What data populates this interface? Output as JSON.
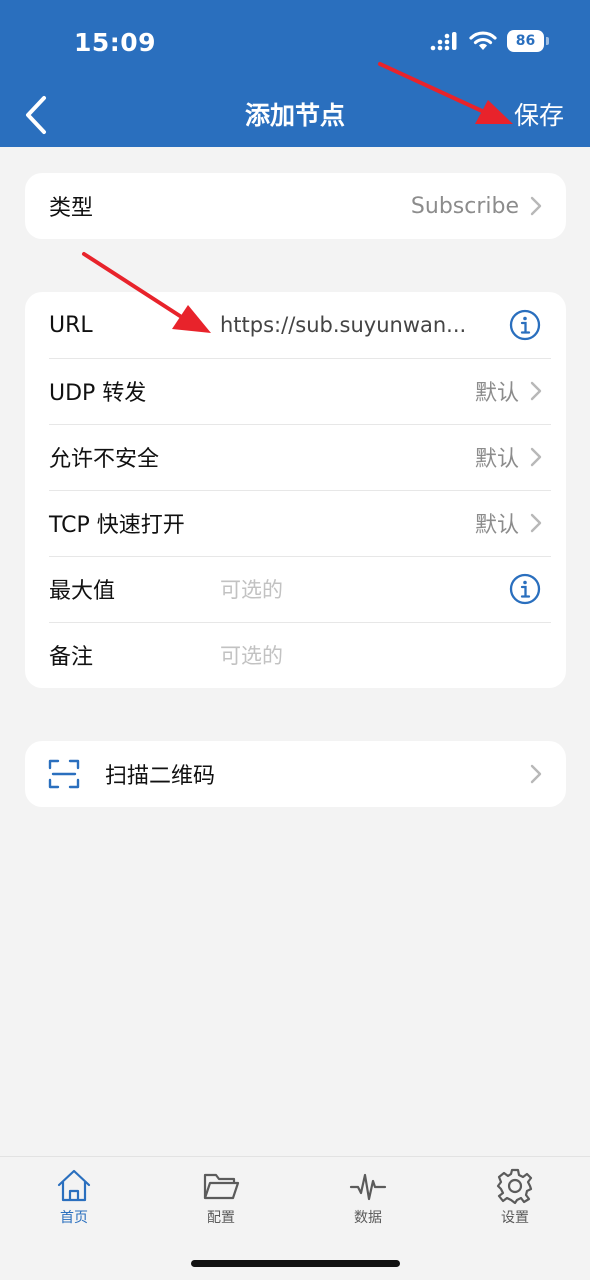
{
  "status_bar": {
    "time": "15:09",
    "battery": "86"
  },
  "nav": {
    "title": "添加节点",
    "save_label": "保存"
  },
  "type_row": {
    "label": "类型",
    "value": "Subscribe"
  },
  "form": {
    "url": {
      "label": "URL",
      "value": "https://sub.suyunwan..."
    },
    "udp": {
      "label": "UDP 转发",
      "value": "默认"
    },
    "insecure": {
      "label": "允许不安全",
      "value": "默认"
    },
    "tcp_fast_open": {
      "label": "TCP 快速打开",
      "value": "默认"
    },
    "max": {
      "label": "最大值",
      "placeholder": "可选的"
    },
    "note": {
      "label": "备注",
      "placeholder": "可选的"
    }
  },
  "scan": {
    "label": "扫描二维码"
  },
  "tabbar": {
    "items": [
      {
        "label": "首页",
        "icon": "home-icon",
        "active": true
      },
      {
        "label": "配置",
        "icon": "folder-icon",
        "active": false
      },
      {
        "label": "数据",
        "icon": "pulse-icon",
        "active": false
      },
      {
        "label": "设置",
        "icon": "gear-icon",
        "active": false
      }
    ]
  },
  "colors": {
    "header": "#2a6fbe",
    "accent": "#2a6fbe",
    "arrow": "#e8232b"
  }
}
